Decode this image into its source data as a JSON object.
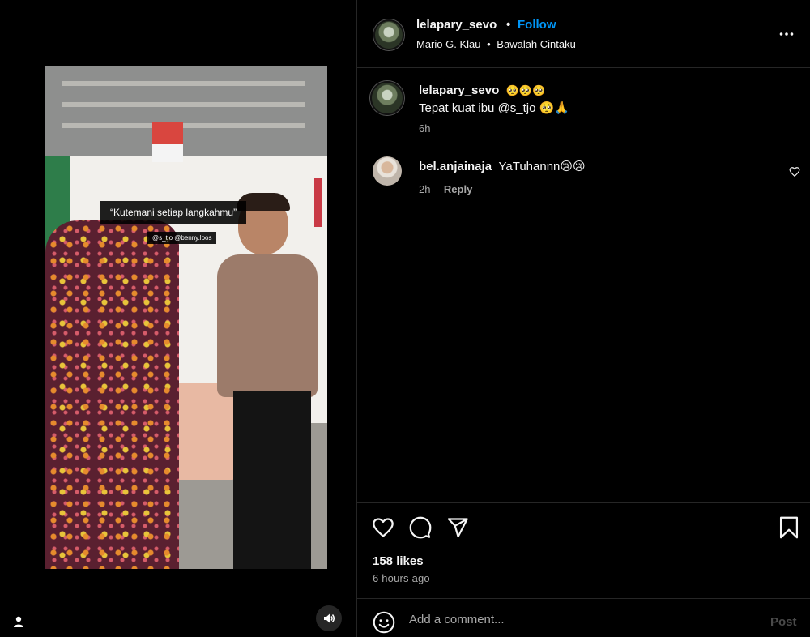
{
  "post": {
    "username": "lelapary_sevo",
    "separator": "•",
    "follow_label": "Follow",
    "audio_artist": "Mario G. Klau",
    "audio_title": "Bawalah Cintaku"
  },
  "media": {
    "caption_overlay": "“Kutemani setiap langkahmu”",
    "tag_overlay": "@s_tjo @benny.loos"
  },
  "comments": [
    {
      "username": "lelapary_sevo",
      "emojis": "🥺🥺🥺",
      "text": "Tepat kuat ibu @s_tjo 🥺🙏",
      "time": "6h"
    },
    {
      "username": "bel.anjainaja",
      "text": "YaTuhannn😢😢",
      "time": "2h",
      "reply_label": "Reply"
    }
  ],
  "stats": {
    "likes": "158 likes",
    "time_ago": "6 hours ago"
  },
  "composer": {
    "placeholder": "Add a comment...",
    "post_label": "Post"
  },
  "colors": {
    "background": "#000000",
    "text": "#f5f5f5",
    "secondary_text": "#a8a8a8",
    "link": "#0095f6",
    "divider": "#262626"
  },
  "icons": [
    "heart-icon",
    "comment-icon",
    "share-icon",
    "bookmark-icon",
    "more-icon",
    "emoji-icon",
    "sound-icon",
    "user-tag-icon"
  ]
}
